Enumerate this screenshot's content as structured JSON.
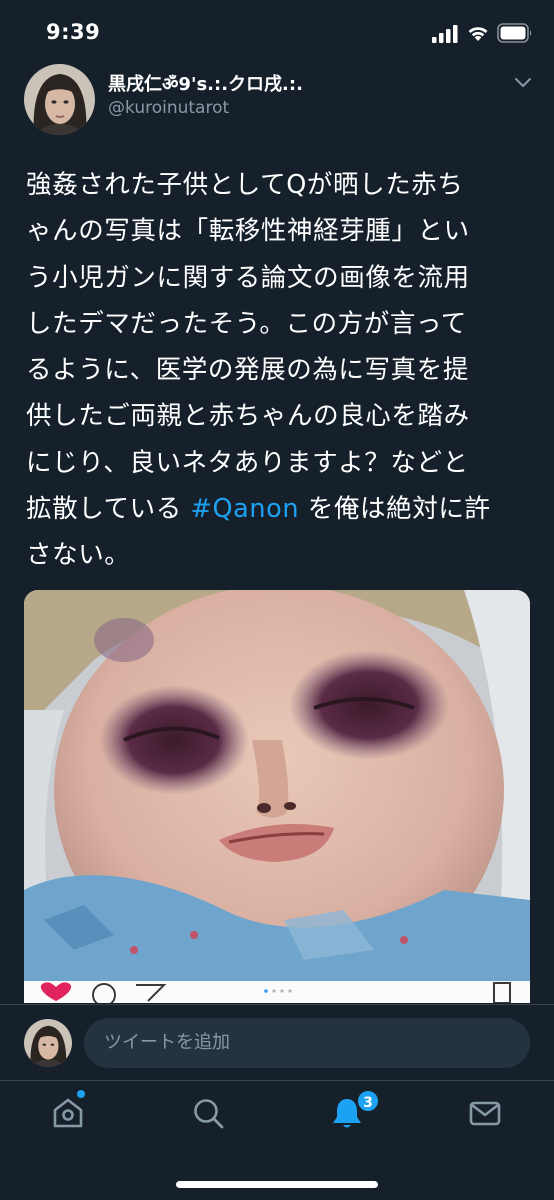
{
  "status_bar": {
    "time": "9:39",
    "icons": [
      "signal-icon",
      "wifi-icon",
      "battery-icon"
    ]
  },
  "tweet": {
    "display_name": "黒戌仁ॐ9's.:.クロ戌.:.",
    "handle": "@kuroinutarot",
    "text_lines": [
      "強姦された子供としてQが晒した赤ち",
      "ゃんの写真は「転移性神経芽腫」とい",
      "う小児ガンに関する論文の画像を流用",
      "したデマだったそう。この方が言って",
      "るように、医学の発展の為に写真を提",
      "供したご両親と赤ちゃんの良心を踏み",
      "にじり、良いネタありますよ？などと"
    ],
    "line8_before": "拡散している ",
    "hashtag": "#Qanon",
    "line8_after": " を俺は絶対に許",
    "line9": "さない。",
    "media_icons": [
      "heart-icon",
      "comment-icon",
      "share-icon",
      "bookmark-icon"
    ]
  },
  "reply_bar": {
    "placeholder": "ツイートを追加"
  },
  "tab_bar": {
    "notification_count": "3",
    "tabs": [
      "home-icon",
      "search-icon",
      "bell-icon",
      "mail-icon"
    ]
  },
  "colors": {
    "background": "#15202b",
    "accent": "#1da1f2",
    "secondary_text": "#8899a6",
    "input_background": "#253341",
    "divider": "#38444d"
  }
}
